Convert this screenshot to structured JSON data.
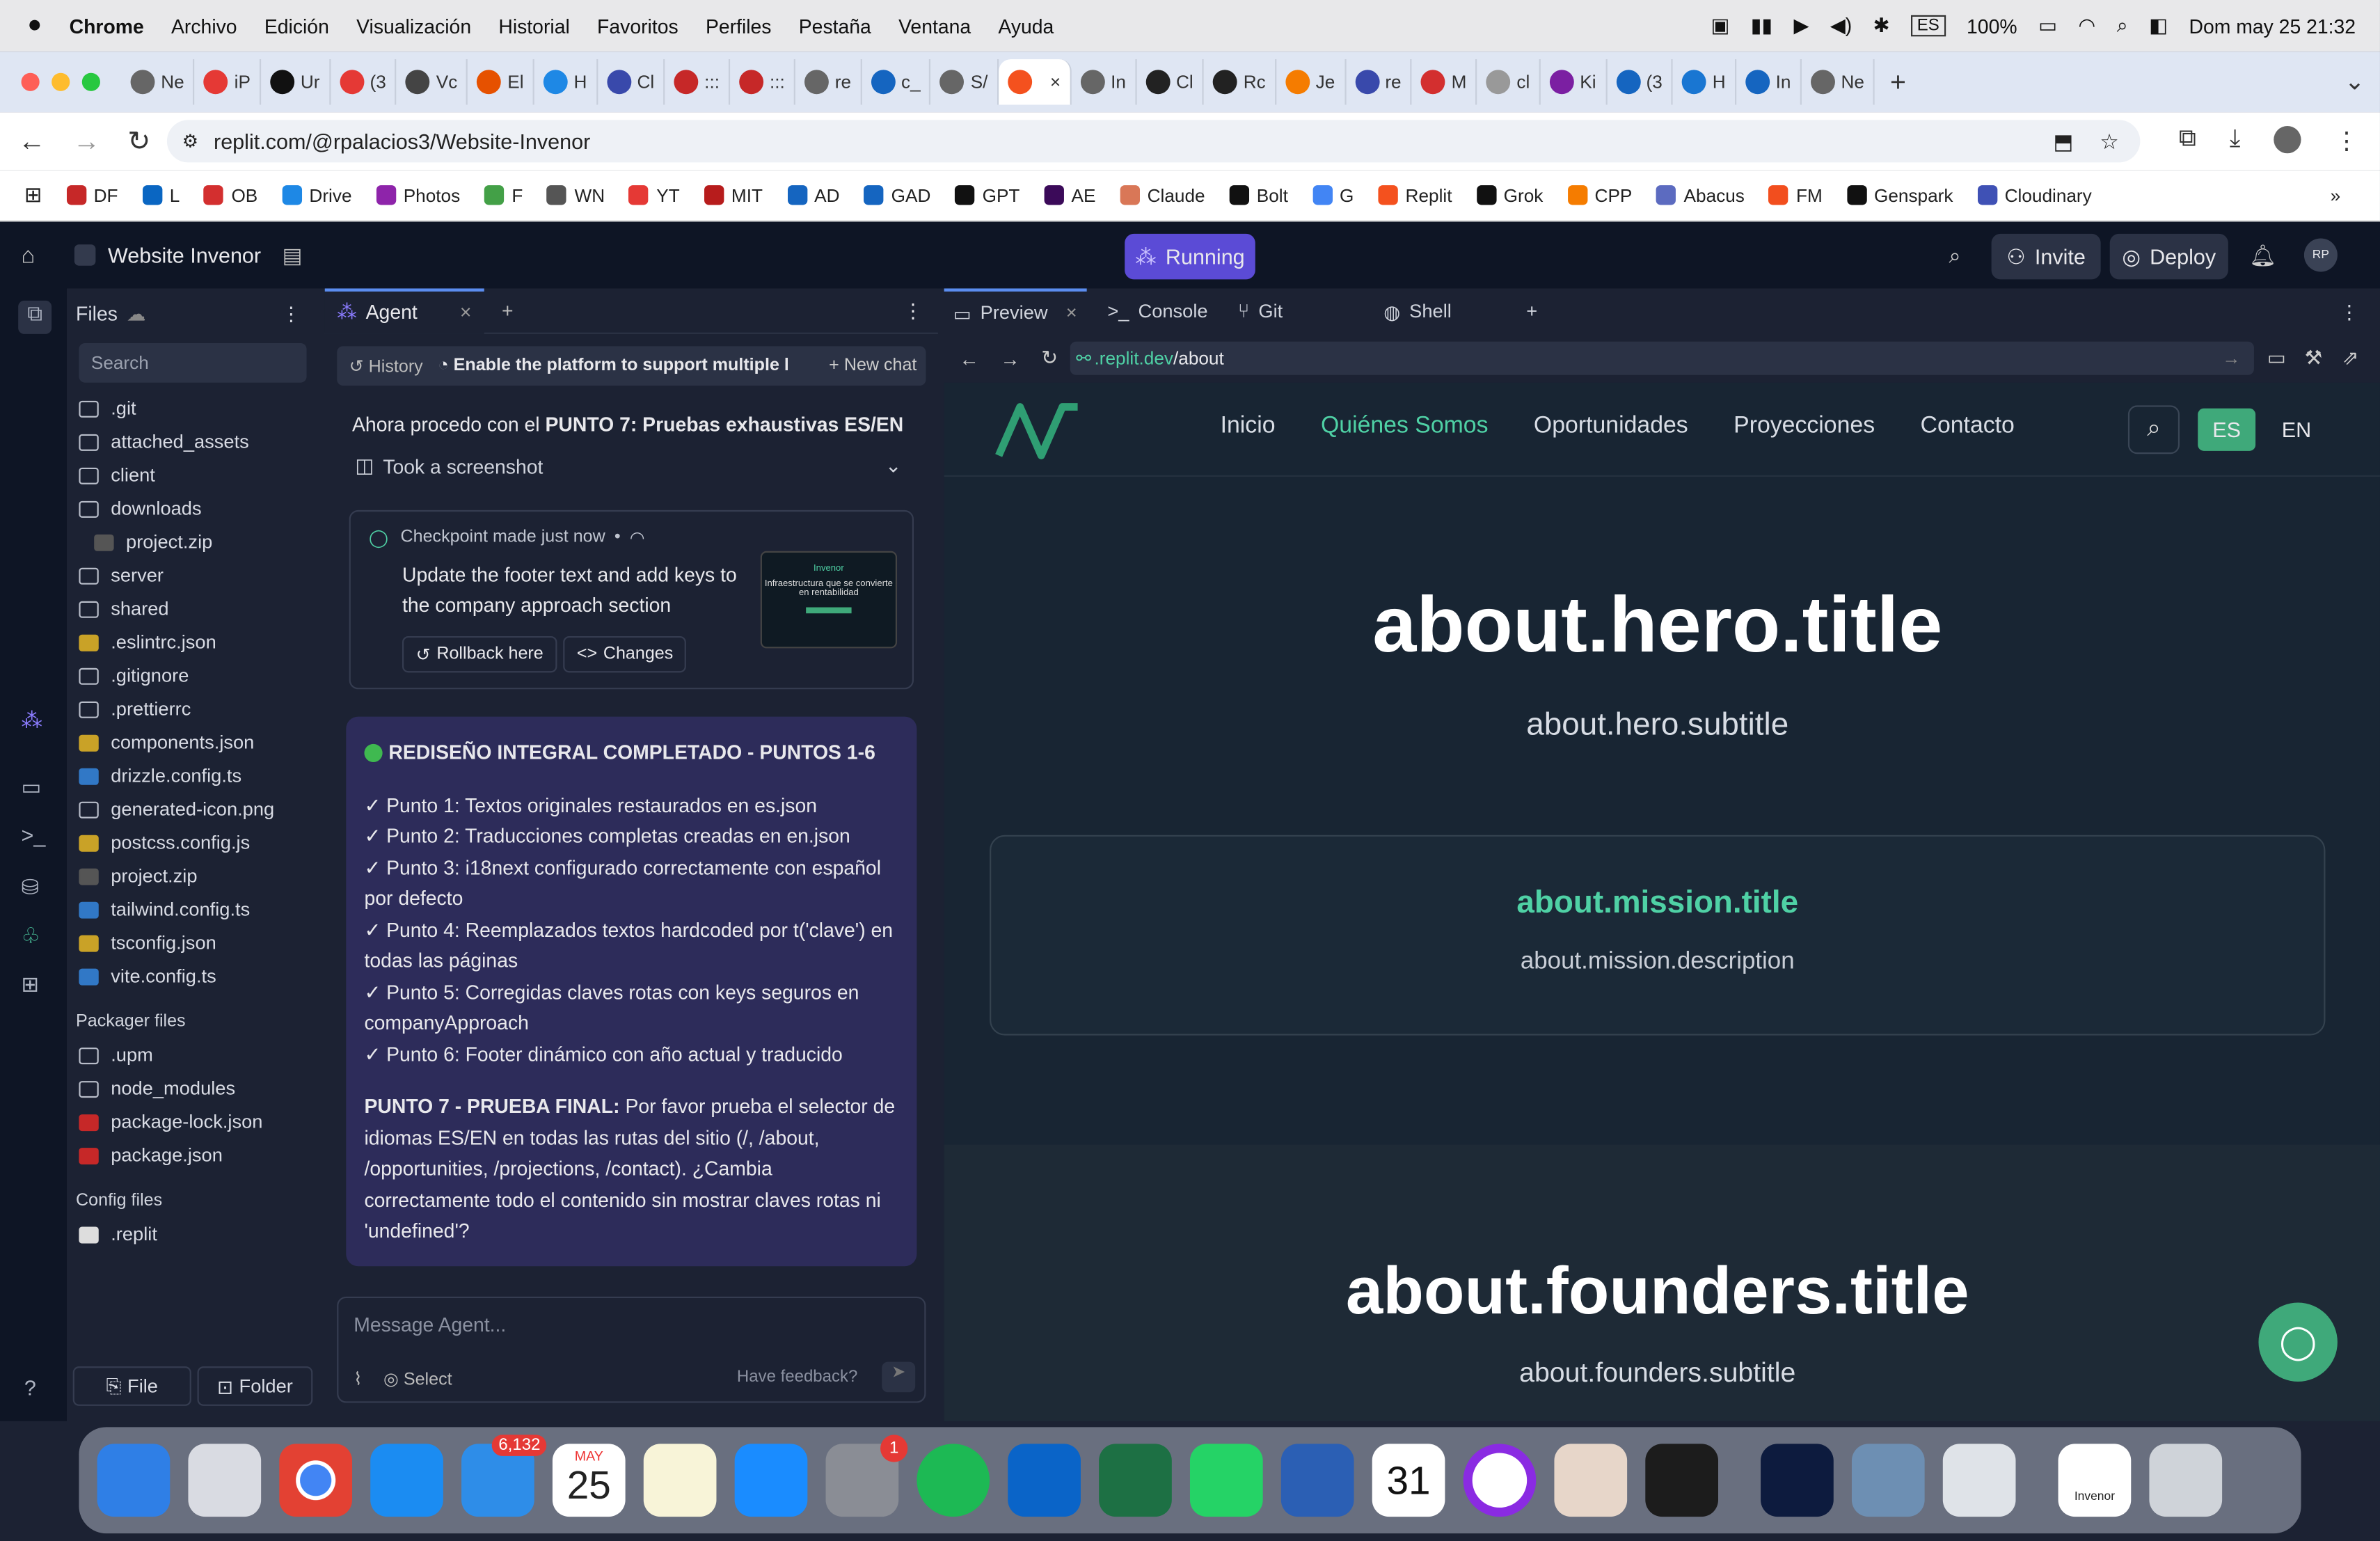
{
  "menubar": {
    "app": "Chrome",
    "items": [
      "Archivo",
      "Edición",
      "Visualización",
      "Historial",
      "Favoritos",
      "Perfiles",
      "Pestaña",
      "Ventana",
      "Ayuda"
    ],
    "lang": "ES",
    "battery": "100%",
    "datetime": "Dom may 25  21:32"
  },
  "browser": {
    "tabs": [
      "Ne",
      "iP",
      "Ur",
      "(3",
      "Vc",
      "El",
      "H",
      "Cl",
      ":::",
      ":::",
      "re",
      "c_",
      "S/",
      "",
      "In",
      "Cl",
      "Rc",
      "Je",
      "re",
      "M",
      "cl",
      "Ki",
      "(3",
      "H",
      "In",
      "Ne"
    ],
    "url": "replit.com/@rpalacios3/Website-Invenor",
    "bookmarks": [
      "DF",
      "L",
      "OB",
      "Drive",
      "Photos",
      "F",
      "WN",
      "YT",
      "MIT",
      "AD",
      "GAD",
      "GPT",
      "AE",
      "Claude",
      "Bolt",
      "G",
      "Replit",
      "Grok",
      "CPP",
      "Abacus",
      "FM",
      "Genspark",
      "Cloudinary"
    ]
  },
  "replit": {
    "project": "Website Invenor",
    "status": "Running",
    "invite": "Invite",
    "deploy": "Deploy",
    "avatar": "RP"
  },
  "files": {
    "title": "Files",
    "search": "Search",
    "items": [
      ".git",
      "attached_assets",
      "client",
      "downloads",
      "project.zip",
      "server",
      "shared",
      ".eslintrc.json",
      ".gitignore",
      ".prettierrc",
      "components.json",
      "drizzle.config.ts",
      "generated-icon.png",
      "postcss.config.js",
      "project.zip",
      "tailwind.config.ts",
      "tsconfig.json",
      "vite.config.ts"
    ],
    "packager_title": "Packager files",
    "packager": [
      ".upm",
      "node_modules",
      "package-lock.json",
      "package.json"
    ],
    "config_title": "Config files",
    "config": [
      ".replit"
    ],
    "file_btn": "File",
    "folder_btn": "Folder"
  },
  "agent": {
    "tab": "Agent",
    "history": "History",
    "thread": "Enable the platform to support multiple l...",
    "new_chat": "New chat",
    "intro": "Ahora procedo con el",
    "intro_bold": "PUNTO 7: Pruebas exhaustivas ES/EN",
    "screenshot": "Took a screenshot",
    "checkpoint": "Checkpoint made just now",
    "checkpoint_text": "Update the footer text and add keys to the company approach section",
    "rollback": "Rollback here",
    "changes": "Changes",
    "thumb_text": "Infraestructura que se convierte en rentabilidad",
    "thumb_logo": "Invenor",
    "summary_title": "REDISEÑO INTEGRAL COMPLETADO - PUNTOS 1-6",
    "points": [
      "✓ Punto 1: Textos originales restaurados en es.json",
      "✓ Punto 2: Traducciones completas creadas en en.json",
      "✓ Punto 3: i18next configurado correctamente con español por defecto",
      "✓ Punto 4: Reemplazados textos hardcoded por t('clave') en todas las páginas",
      "✓ Punto 5: Corregidas claves rotas con keys seguros en companyApproach",
      "✓ Punto 6: Footer dinámico con año actual y traducido"
    ],
    "final_bold": "PUNTO 7 - PRUEBA FINAL:",
    "final": "Por favor prueba el selector de idiomas ES/EN en todas las rutas del sitio (/, /about, /opportunities, /projections, /contact). ¿Cambia correctamente todo el contenido sin mostrar claves rotas ni 'undefined'?",
    "placeholder": "Message Agent...",
    "select": "Select",
    "feedback": "Have feedback?"
  },
  "panes": {
    "tabs": [
      "Preview",
      "Console",
      "Git",
      "Shell"
    ],
    "url_prefix": ".replit.dev",
    "url_path": "/about"
  },
  "site": {
    "nav": [
      "Inicio",
      "Quiénes Somos",
      "Oportunidades",
      "Proyecciones",
      "Contacto"
    ],
    "lang_es": "ES",
    "lang_en": "EN",
    "hero_title": "about.hero.title",
    "hero_subtitle": "about.hero.subtitle",
    "mission_title": "about.mission.title",
    "mission_desc": "about.mission.description",
    "founders_title": "about.founders.title",
    "founders_subtitle": "about.founders.subtitle"
  },
  "dock": {
    "mail_badge": "6,132",
    "cal_month": "MAY",
    "cal_day": "25",
    "settings_badge": "1",
    "cal2": "31",
    "invenor": "Invenor"
  },
  "colors": {
    "accent_green": "#4fd1a5",
    "replit_bg": "#0e1525",
    "panel": "#1c2233",
    "running": "#5b4bd6",
    "lang_active": "#3fa97a"
  }
}
